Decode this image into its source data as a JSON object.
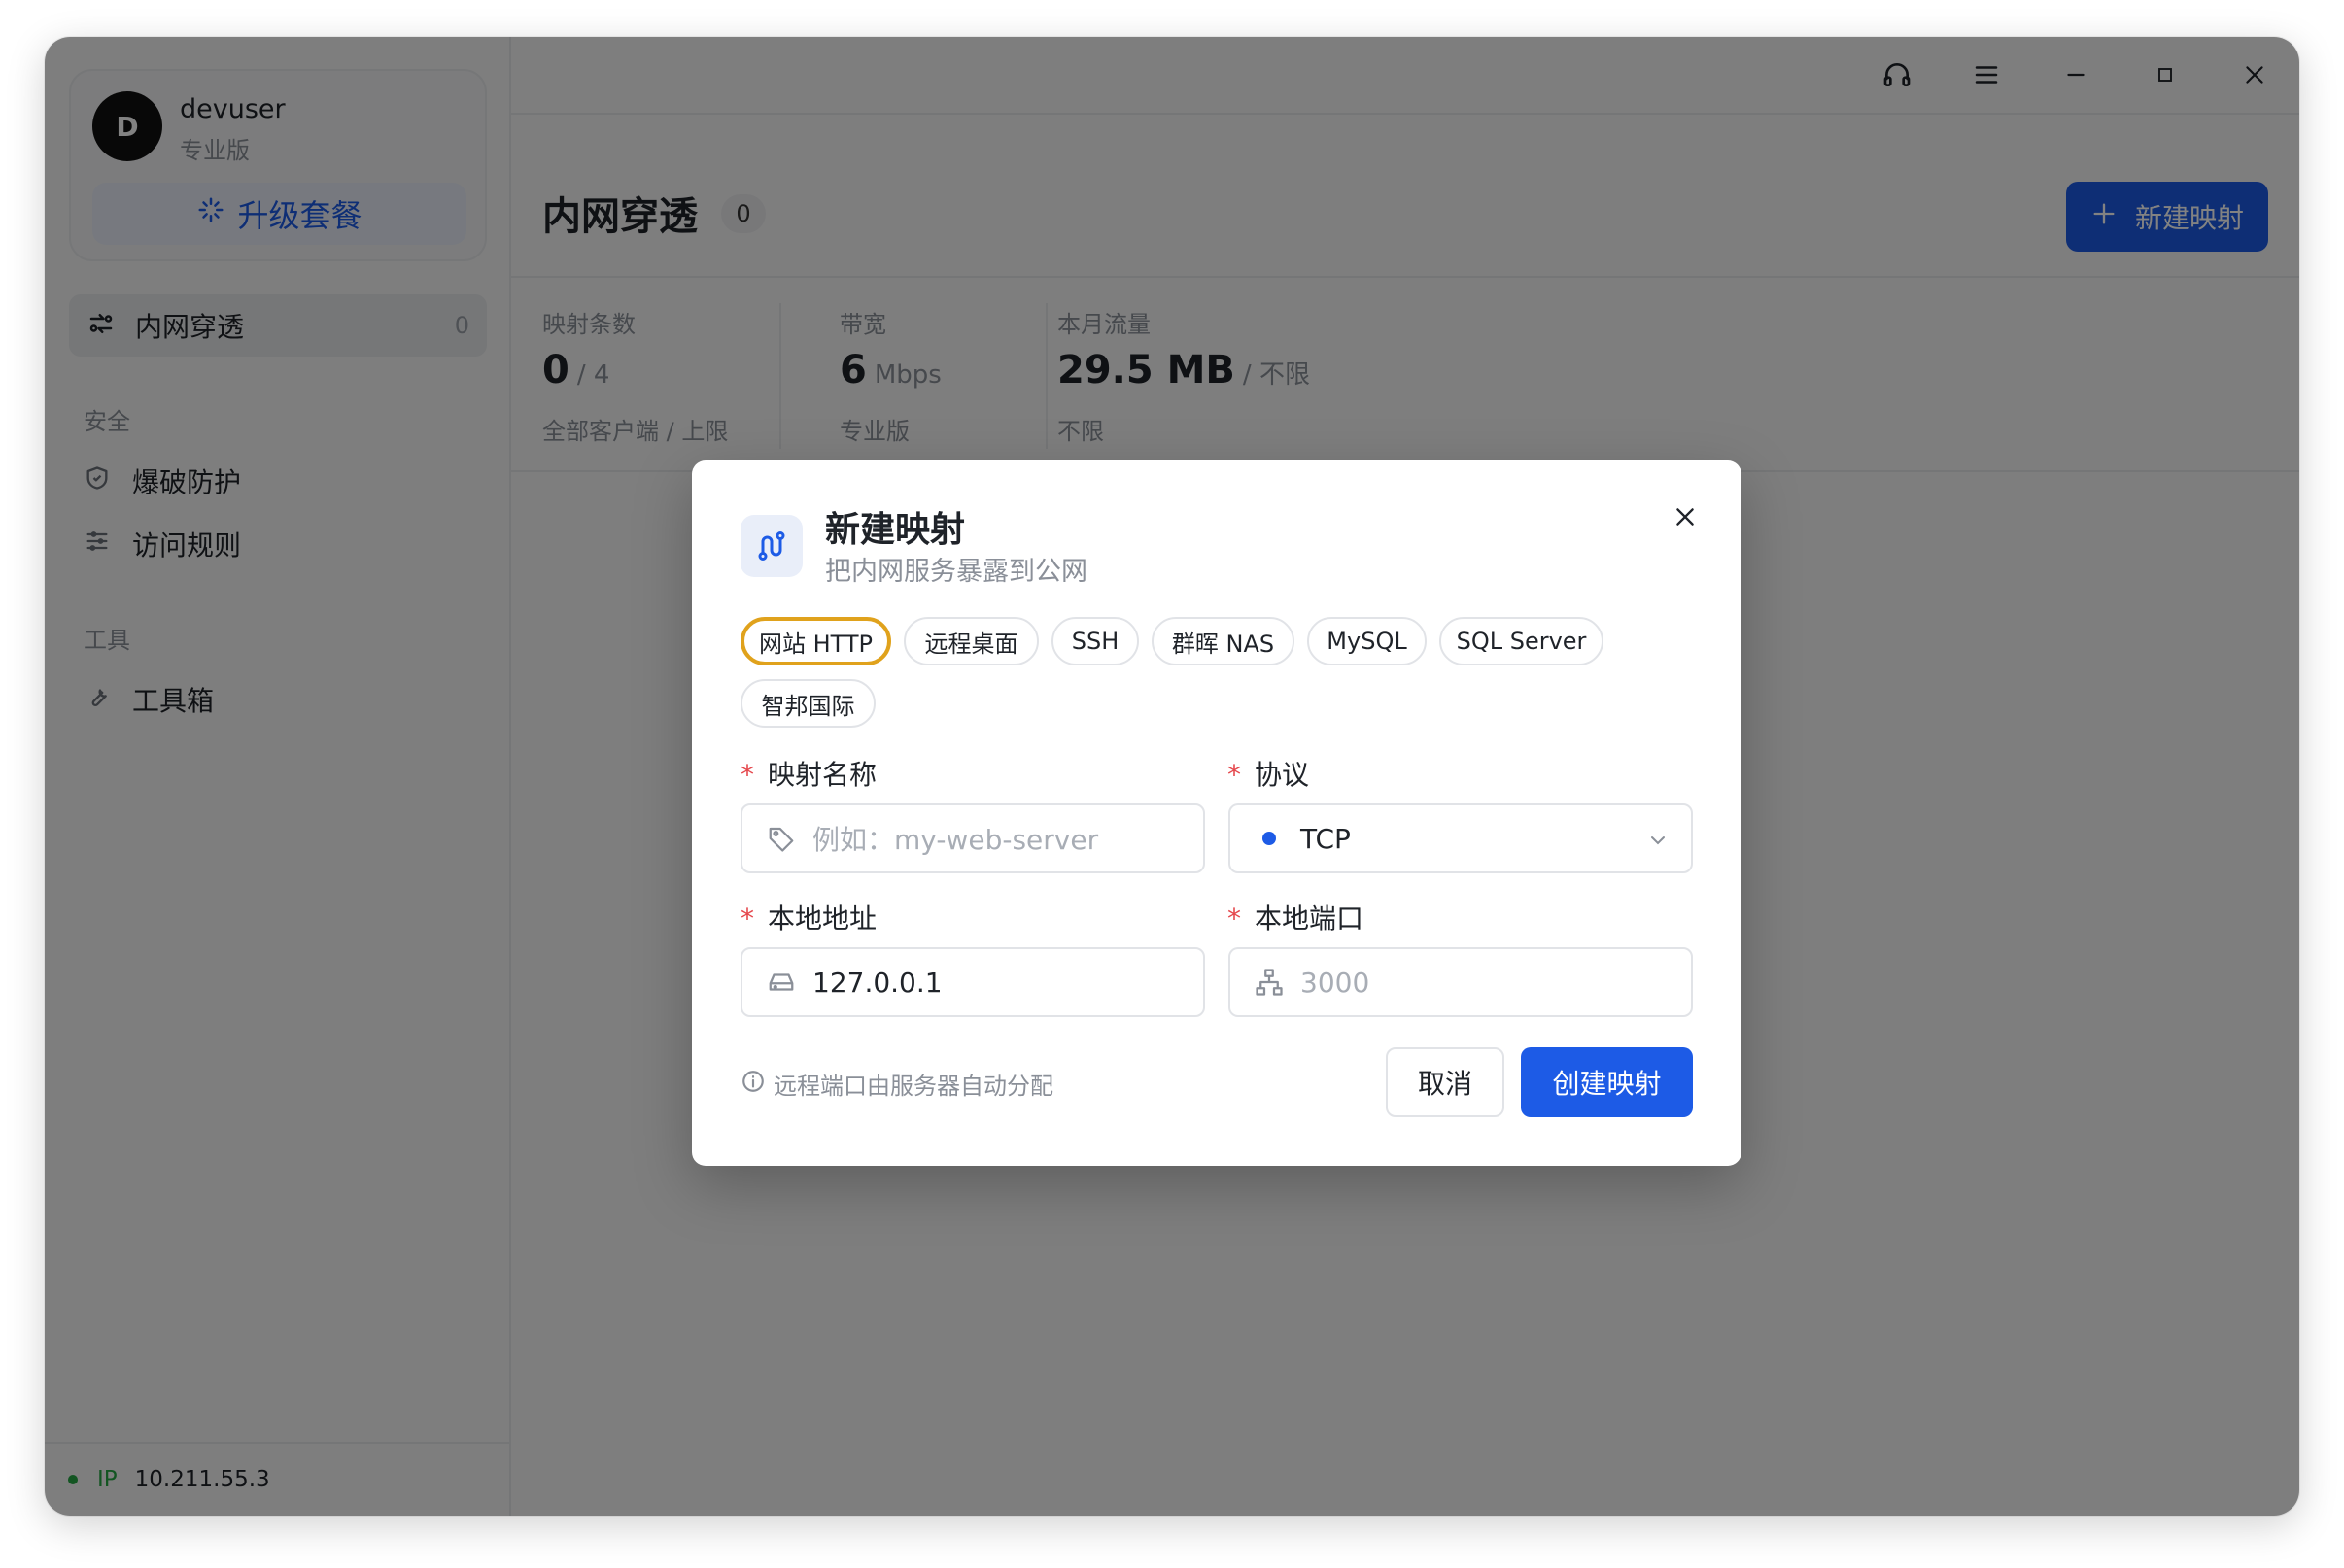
{
  "user": {
    "avatar_letter": "D",
    "name": "devuser",
    "plan": "专业版",
    "upgrade_label": "升级套餐"
  },
  "sidebar": {
    "active_item": {
      "label": "内网穿透",
      "count": "0"
    },
    "sections": [
      {
        "title": "安全",
        "items": [
          {
            "label": "爆破防护",
            "icon": "shield-icon"
          },
          {
            "label": "访问规则",
            "icon": "sliders-icon"
          }
        ]
      },
      {
        "title": "工具",
        "items": [
          {
            "label": "工具箱",
            "icon": "wrench-icon"
          }
        ]
      }
    ],
    "footer": {
      "ip_label": "IP",
      "ip_value": "10.211.55.3"
    }
  },
  "header": {
    "title": "内网穿透",
    "count": "0",
    "new_button_label": "新建映射"
  },
  "stats": [
    {
      "label": "映射条数",
      "value": "0",
      "unit": "/ 4",
      "sub": "全部客户端 / 上限"
    },
    {
      "label": "带宽",
      "value": "6",
      "unit": "Mbps",
      "sub": "专业版"
    },
    {
      "label": "本月流量",
      "value": "29.5 MB",
      "unit": "/ 不限",
      "sub": "不限"
    }
  ],
  "modal": {
    "title": "新建映射",
    "subtitle": "把内网服务暴露到公网",
    "presets": [
      "网站 HTTP",
      "远程桌面",
      "SSH",
      "群晖 NAS",
      "MySQL",
      "SQL Server",
      "智邦国际"
    ],
    "selected_preset": "网站 HTTP",
    "fields": {
      "name": {
        "label": "映射名称",
        "placeholder": "例如：my-web-server"
      },
      "protocol": {
        "label": "协议",
        "value": "TCP"
      },
      "local_address": {
        "label": "本地地址",
        "value": "127.0.0.1"
      },
      "local_port": {
        "label": "本地端口",
        "placeholder": "3000"
      }
    },
    "hint": "远程端口由服务器自动分配",
    "cancel_label": "取消",
    "create_label": "创建映射"
  },
  "colors": {
    "accent": "#1d5be6",
    "selected_chip_border": "#e0a21c",
    "required": "#e5484d",
    "online": "#27a844"
  }
}
